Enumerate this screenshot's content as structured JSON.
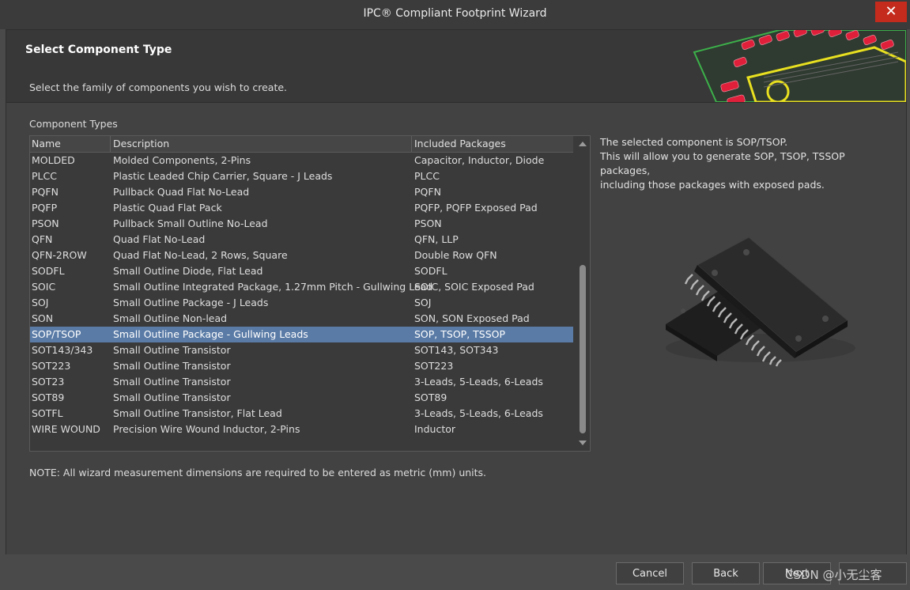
{
  "window": {
    "title": "IPC® Compliant Footprint Wizard",
    "close_glyph": "✕"
  },
  "header": {
    "title": "Select Component Type"
  },
  "instruction": "Select the family of components you wish to create.",
  "component_types": {
    "label": "Component Types",
    "columns": [
      "Name",
      "Description",
      "Included Packages"
    ],
    "rows": [
      {
        "name": "MOLDED",
        "description": "Molded Components, 2-Pins",
        "packages": "Capacitor, Inductor, Diode"
      },
      {
        "name": "PLCC",
        "description": "Plastic Leaded Chip Carrier, Square - J Leads",
        "packages": "PLCC"
      },
      {
        "name": "PQFN",
        "description": "Pullback Quad Flat No-Lead",
        "packages": "PQFN"
      },
      {
        "name": "PQFP",
        "description": "Plastic Quad Flat Pack",
        "packages": "PQFP, PQFP Exposed Pad"
      },
      {
        "name": "PSON",
        "description": "Pullback Small Outline No-Lead",
        "packages": "PSON"
      },
      {
        "name": "QFN",
        "description": "Quad Flat No-Lead",
        "packages": "QFN, LLP"
      },
      {
        "name": "QFN-2ROW",
        "description": "Quad Flat No-Lead, 2 Rows, Square",
        "packages": "Double Row QFN"
      },
      {
        "name": "SODFL",
        "description": "Small Outline Diode, Flat Lead",
        "packages": "SODFL"
      },
      {
        "name": "SOIC",
        "description": "Small Outline Integrated Package, 1.27mm Pitch - Gullwing Lead",
        "packages": "SOIC, SOIC Exposed Pad"
      },
      {
        "name": "SOJ",
        "description": "Small Outline Package - J Leads",
        "packages": "SOJ"
      },
      {
        "name": "SON",
        "description": "Small Outline Non-lead",
        "packages": "SON, SON Exposed Pad"
      },
      {
        "name": "SOP/TSOP",
        "description": "Small Outline Package - Gullwing Leads",
        "packages": "SOP, TSOP, TSSOP"
      },
      {
        "name": "SOT143/343",
        "description": "Small Outline Transistor",
        "packages": "SOT143, SOT343"
      },
      {
        "name": "SOT223",
        "description": "Small Outline Transistor",
        "packages": "SOT223"
      },
      {
        "name": "SOT23",
        "description": "Small Outline Transistor",
        "packages": "3-Leads, 5-Leads, 6-Leads"
      },
      {
        "name": "SOT89",
        "description": "Small Outline Transistor",
        "packages": "SOT89"
      },
      {
        "name": "SOTFL",
        "description": "Small Outline Transistor, Flat Lead",
        "packages": "3-Leads, 5-Leads, 6-Leads"
      },
      {
        "name": "WIRE WOUND",
        "description": "Precision Wire Wound Inductor, 2-Pins",
        "packages": "Inductor"
      }
    ],
    "selected_index": 11
  },
  "info": {
    "line1": "The selected component is SOP/TSOP.",
    "line2": "This will allow you to generate SOP, TSOP, TSSOP packages,",
    "line3": "including those packages with exposed pads."
  },
  "note": "NOTE: All wizard measurement dimensions are required to be entered as metric (mm) units.",
  "buttons": {
    "cancel": "Cancel",
    "back": "Back",
    "next": "Next"
  },
  "watermark": "CSDN @小无尘客",
  "colors": {
    "selection": "#5a7ba6",
    "pad_red": "#e0203a",
    "outline_yellow": "#e8e020",
    "board_green": "#3cb04a"
  }
}
